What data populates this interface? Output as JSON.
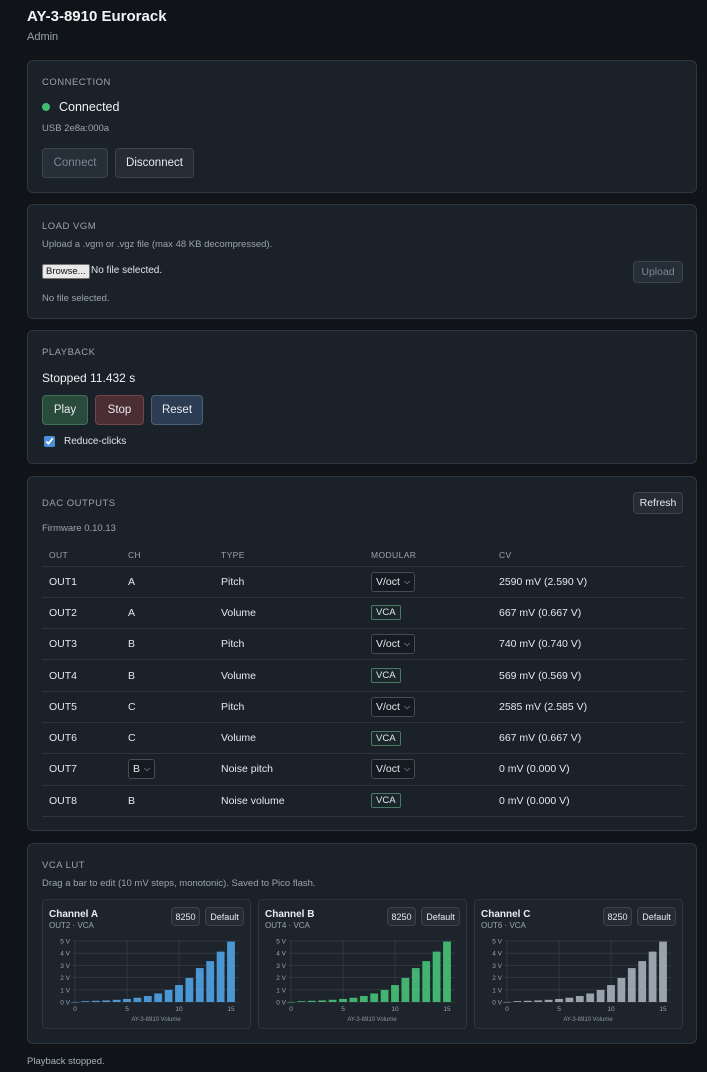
{
  "app": {
    "title": "AY-3-8910 Eurorack",
    "subtitle": "Admin"
  },
  "connection": {
    "section_title": "CONNECTION",
    "status": "Connected",
    "status_color": "#3fbf6e",
    "device": "USB 2e8a:000a",
    "connect_label": "Connect",
    "disconnect_label": "Disconnect"
  },
  "load_vgm": {
    "section_title": "LOAD VGM",
    "hint": "Upload a .vgm or .vgz file (max 48 KB decompressed).",
    "browse_label": "Browse...",
    "file_status": "No file selected.",
    "upload_label": "Upload",
    "message": "No file selected."
  },
  "playback": {
    "section_title": "PLAYBACK",
    "status": "Stopped 11.432 s",
    "play_label": "Play",
    "stop_label": "Stop",
    "reset_label": "Reset",
    "reduce_clicks_label": "Reduce-clicks",
    "reduce_clicks_checked": true
  },
  "dac": {
    "section_title": "DAC OUTPUTS",
    "firmware": "Firmware 0.10.13",
    "refresh_label": "Refresh",
    "columns": [
      "OUT",
      "CH",
      "TYPE",
      "MODULAR",
      "CV"
    ],
    "rows": [
      {
        "out": "OUT1",
        "ch": "A",
        "ch_select": false,
        "type": "Pitch",
        "modular": "V/oct",
        "modular_select": true,
        "cv": "2590 mV (2.590 V)"
      },
      {
        "out": "OUT2",
        "ch": "A",
        "ch_select": false,
        "type": "Volume",
        "modular": "VCA",
        "modular_select": false,
        "cv": "667 mV (0.667 V)"
      },
      {
        "out": "OUT3",
        "ch": "B",
        "ch_select": false,
        "type": "Pitch",
        "modular": "V/oct",
        "modular_select": true,
        "cv": "740 mV (0.740 V)"
      },
      {
        "out": "OUT4",
        "ch": "B",
        "ch_select": false,
        "type": "Volume",
        "modular": "VCA",
        "modular_select": false,
        "cv": "569 mV (0.569 V)"
      },
      {
        "out": "OUT5",
        "ch": "C",
        "ch_select": false,
        "type": "Pitch",
        "modular": "V/oct",
        "modular_select": true,
        "cv": "2585 mV (2.585 V)"
      },
      {
        "out": "OUT6",
        "ch": "C",
        "ch_select": false,
        "type": "Volume",
        "modular": "VCA",
        "modular_select": false,
        "cv": "667 mV (0.667 V)"
      },
      {
        "out": "OUT7",
        "ch": "B",
        "ch_select": true,
        "type": "Noise pitch",
        "modular": "V/oct",
        "modular_select": true,
        "cv": "0 mV (0.000 V)"
      },
      {
        "out": "OUT8",
        "ch": "B",
        "ch_select": false,
        "type": "Noise volume",
        "modular": "VCA",
        "modular_select": false,
        "cv": "0 mV (0.000 V)"
      }
    ]
  },
  "vca_lut": {
    "section_title": "VCA LUT",
    "hint": "Drag a bar to edit (10 mV steps, monotonic). Saved to Pico flash.",
    "channels": [
      {
        "title": "Channel A",
        "sub": "OUT2 · VCA",
        "value": "8250",
        "default_label": "Default",
        "color": "#4a97d4"
      },
      {
        "title": "Channel B",
        "sub": "OUT4 · VCA",
        "value": "8250",
        "default_label": "Default",
        "color": "#42b46f"
      },
      {
        "title": "Channel C",
        "sub": "OUT6 · VCA",
        "value": "8250",
        "default_label": "Default",
        "color": "#9aa2ad"
      }
    ],
    "chart_data": {
      "type": "bar",
      "x": [
        0,
        1,
        2,
        3,
        4,
        5,
        6,
        7,
        8,
        9,
        10,
        11,
        12,
        13,
        14,
        15
      ],
      "values": [
        0,
        0.07,
        0.1,
        0.13,
        0.18,
        0.25,
        0.35,
        0.49,
        0.7,
        0.99,
        1.39,
        1.97,
        2.78,
        3.35,
        4.13,
        4.95
      ],
      "xticks": [
        "0",
        "5",
        "10",
        "15"
      ],
      "yticks": [
        "0 V",
        "1 V",
        "2 V",
        "3 V",
        "4 V",
        "5 V"
      ],
      "ylim": [
        0,
        5
      ],
      "xlabel": "AY-3-8910 Volume"
    }
  },
  "footer": {
    "status": "Playback stopped."
  }
}
